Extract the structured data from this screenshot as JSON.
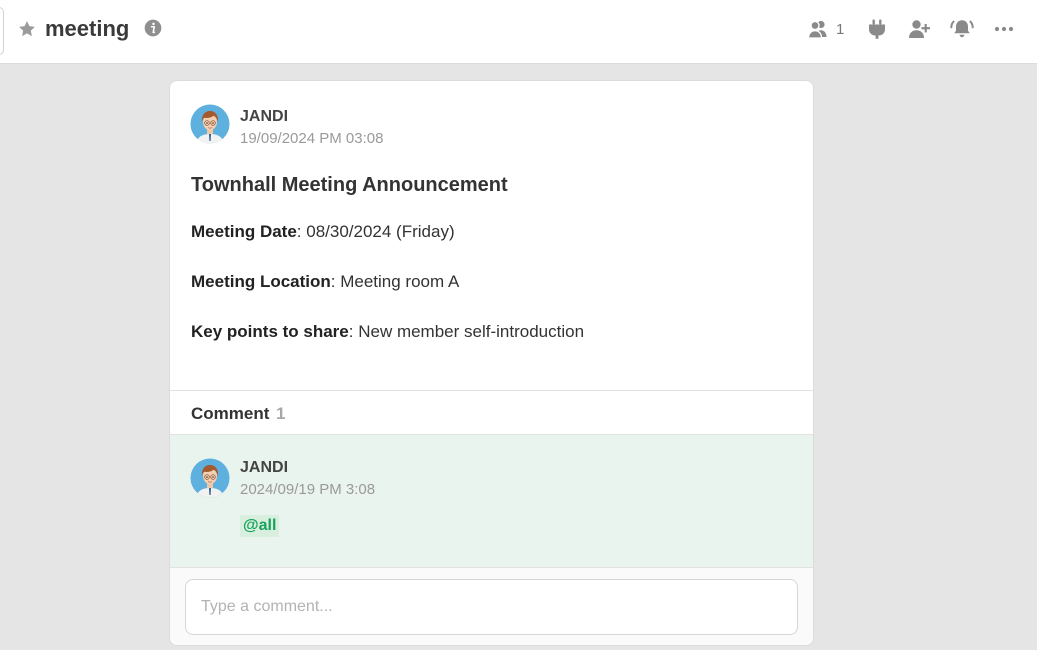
{
  "header": {
    "title": "meeting",
    "member_count": "1",
    "icons": [
      "star-icon",
      "info-icon",
      "members-icon",
      "connect-plug-icon",
      "invite-user-icon",
      "notification-bell-icon",
      "more-icon"
    ]
  },
  "post": {
    "author": "JANDI",
    "timestamp": "19/09/2024 PM 03:08",
    "title": "Townhall Meeting Announcement",
    "lines": [
      {
        "label": "Meeting Date",
        "value": ": 08/30/2024 (Friday)"
      },
      {
        "label": "Meeting Location",
        "value": ": Meeting room A"
      },
      {
        "label": "Key points to share",
        "value": ": New member self-introduction"
      }
    ]
  },
  "comments": {
    "label": "Comment",
    "count": "1",
    "items": [
      {
        "author": "JANDI",
        "timestamp": "2024/09/19 PM 3:08",
        "mention": "@all"
      }
    ],
    "input_placeholder": "Type a comment..."
  },
  "colors": {
    "background": "#e5e5e5",
    "comment_highlight": "#eaf4ee",
    "mention_text": "#19a35a",
    "icon_gray": "#8a8a8a"
  }
}
